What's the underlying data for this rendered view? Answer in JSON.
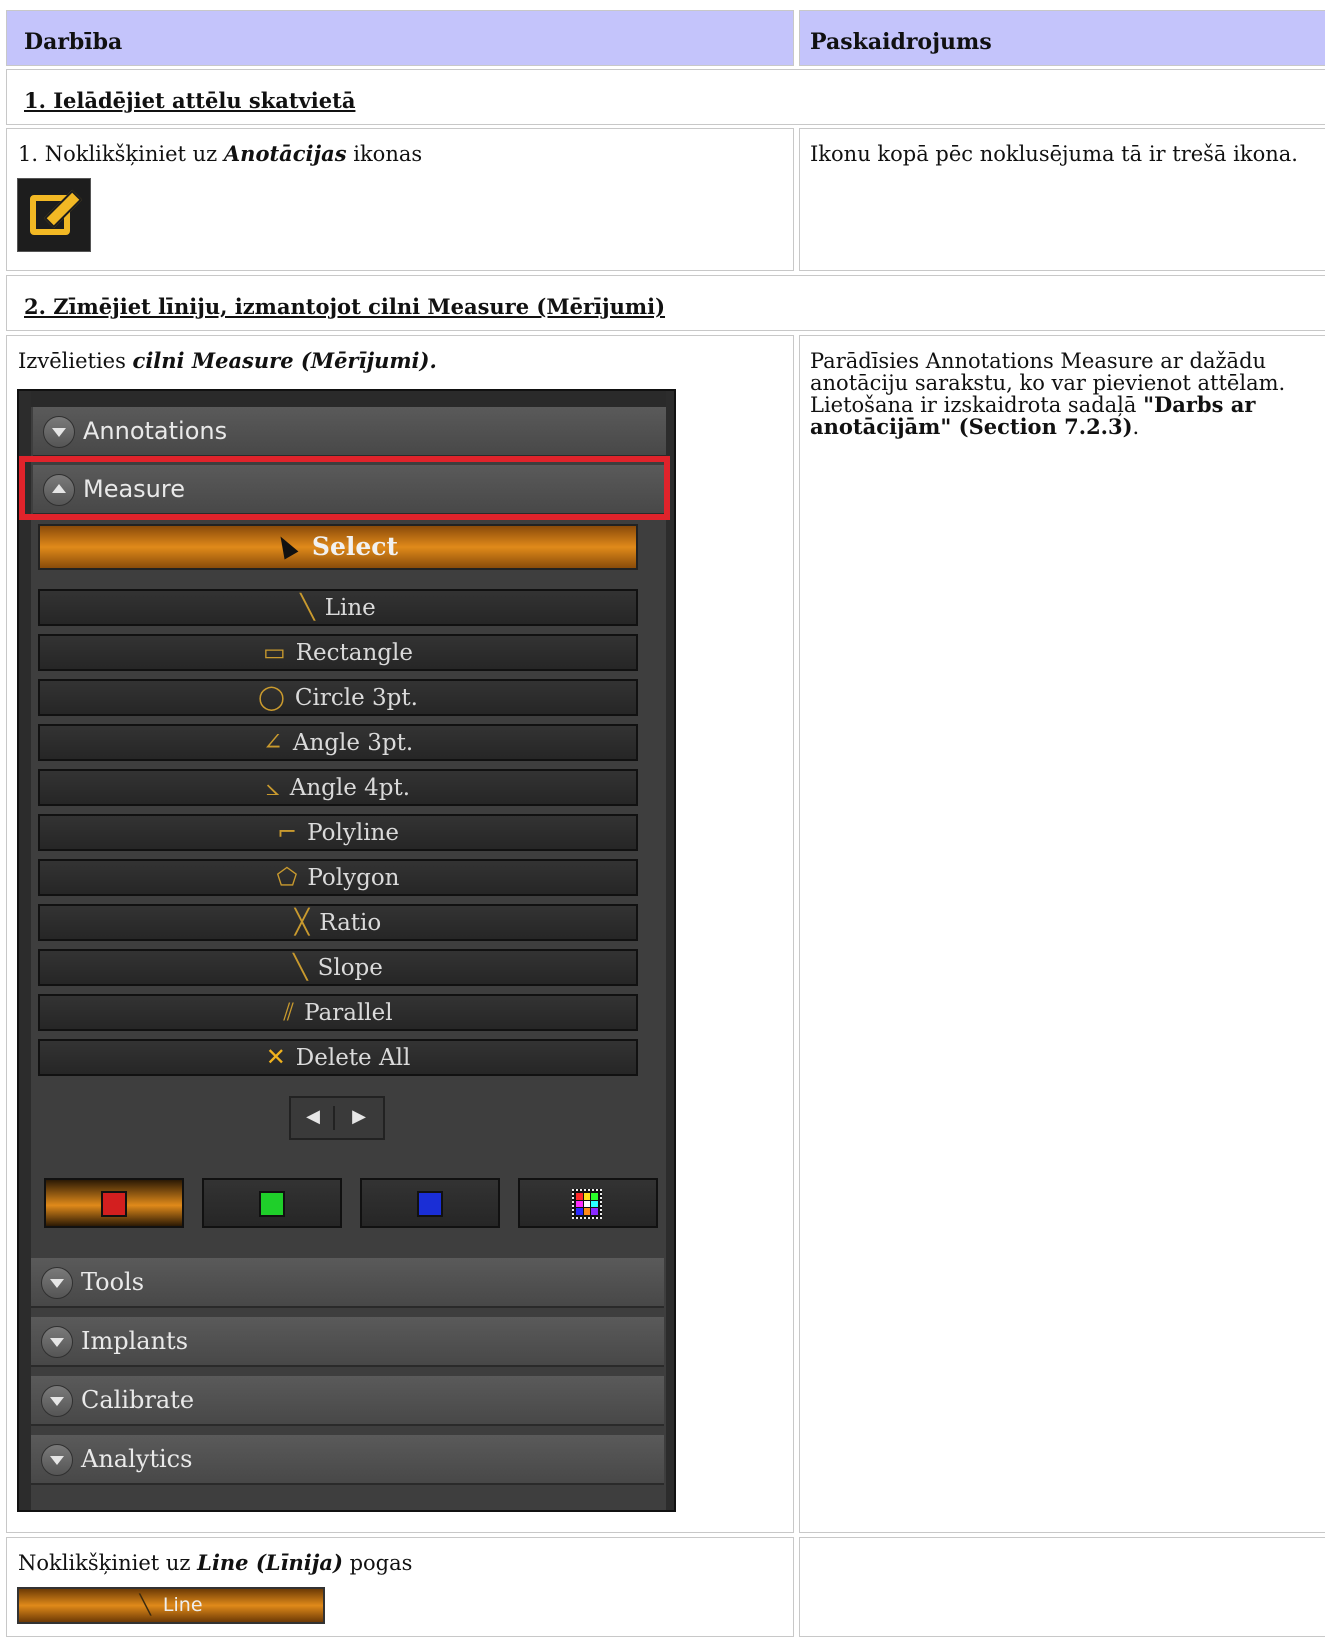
{
  "table": {
    "header": {
      "col1": "Darbība",
      "col2": "Paskaidrojums"
    },
    "section1": {
      "title": "1. Ielādējiet attēlu skatvietā"
    },
    "row1": {
      "action_prefix": "1. Noklikšķiniet uz ",
      "action_bold": "Anotācijas",
      "action_suffix": " ikonas",
      "explanation": "Ikonu kopā pēc noklusējuma tā ir trešā ikona."
    },
    "section2": {
      "title": "2. Zīmējiet līniju, izmantojot cilni Measure (Mērījumi)"
    },
    "row2": {
      "action_prefix": "Izvēlieties ",
      "action_bold": "cilni Measure (Mērījumi).",
      "explanation_line1": "Parādīsies Annotations Measure ar dažādu",
      "explanation_line2": "anotāciju sarakstu, ko var pievienot attēlam.",
      "explanation_line3_prefix": "Lietošana ir izskaidrota sadaļā ",
      "explanation_line3_bold": "\"Darbs ar",
      "explanation_line4_bold": "anotācijām\" (Section 7.2.3)",
      "explanation_line4_suffix": "."
    },
    "row3": {
      "action_prefix": "Noklikšķiniet uz ",
      "action_bold": "Line (Līnija)",
      "action_suffix": " pogas",
      "explanation": ""
    }
  },
  "panel": {
    "sections": {
      "annotations": "Annotations",
      "measure": "Measure",
      "tools": "Tools",
      "implants": "Implants",
      "calibrate": "Calibrate",
      "analytics": "Analytics"
    },
    "select_label": "Select",
    "tools": [
      {
        "label": "Line",
        "icon": "line-icon",
        "glyph": "╲"
      },
      {
        "label": "Rectangle",
        "icon": "rectangle-icon",
        "glyph": "▭"
      },
      {
        "label": "Circle 3pt.",
        "icon": "circle-icon",
        "glyph": "◯"
      },
      {
        "label": "Angle 3pt.",
        "icon": "angle-3pt-icon",
        "glyph": "∠"
      },
      {
        "label": "Angle 4pt.",
        "icon": "angle-4pt-icon",
        "glyph": "⦣"
      },
      {
        "label": "Polyline",
        "icon": "polyline-icon",
        "glyph": "⌐"
      },
      {
        "label": "Polygon",
        "icon": "polygon-icon",
        "glyph": "⬠"
      },
      {
        "label": "Ratio",
        "icon": "ratio-icon",
        "glyph": "╳"
      },
      {
        "label": "Slope",
        "icon": "slope-icon",
        "glyph": "╲"
      },
      {
        "label": "Parallel",
        "icon": "parallel-icon",
        "glyph": "⫽"
      },
      {
        "label": "Delete All",
        "icon": "delete-all-icon",
        "glyph": "✕"
      }
    ],
    "pager": {
      "prev": "◀",
      "next": "▶"
    },
    "colors": {
      "red": "#d31f1f",
      "green": "#1fcf2a",
      "blue": "#1a2ed6",
      "accent": "#e08a1a"
    }
  },
  "line_button": {
    "label": "Line"
  }
}
